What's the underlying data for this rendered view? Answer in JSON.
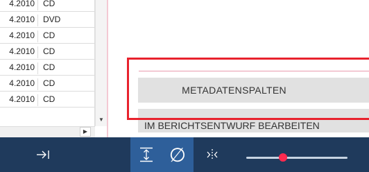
{
  "list": {
    "rows": [
      {
        "date": "4.2010",
        "media": "CD"
      },
      {
        "date": "4.2010",
        "media": "DVD"
      },
      {
        "date": "4.2010",
        "media": "CD"
      },
      {
        "date": "4.2010",
        "media": "CD"
      },
      {
        "date": "4.2010",
        "media": "CD"
      },
      {
        "date": "4.2010",
        "media": "CD"
      },
      {
        "date": "4.2010",
        "media": "CD"
      }
    ],
    "scroll_down_glyph": "▼",
    "scroll_right_glyph": "▶"
  },
  "actions": {
    "metadata_columns_label": "METADATENSPALTEN",
    "edit_in_draft_label": "IM BERICHTSENTWURF BEARBEITEN"
  },
  "toolbar": {
    "collapse_icon": "arrow-to-right-icon",
    "fit_height_icon": "fit-height-icon",
    "none_icon": "empty-set-icon",
    "none_glyph": "∅",
    "split_icon": "split-columns-icon",
    "zoom_level": 0.36,
    "accent_color": "#ff2a4f",
    "bar_color": "#1f3a5c",
    "active_color": "#2e5f9a"
  },
  "highlight_color": "#e8222d"
}
